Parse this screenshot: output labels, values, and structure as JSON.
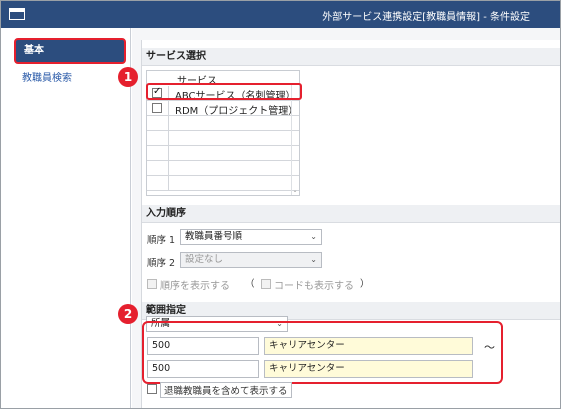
{
  "window": {
    "title": "外部サービス連携設定[教職員情報] - 条件設定",
    "icon": "window-icon"
  },
  "sidebar": {
    "items": [
      {
        "label": "基本",
        "active": true
      },
      {
        "label": "教職員検索",
        "active": false
      }
    ]
  },
  "badges": {
    "one": "1",
    "two": "2"
  },
  "service_section": {
    "heading": "サービス選択",
    "column_header": "サービス",
    "rows": [
      {
        "label": "ABCサービス（名刺管理）",
        "checked": true
      },
      {
        "label": "RDM（プロジェクト管理）",
        "checked": false
      }
    ]
  },
  "order_section": {
    "heading": "入力順序",
    "order1_label": "順序 1",
    "order1_value": "教職員番号順",
    "order2_label": "順序 2",
    "order2_value": "設定なし",
    "show_order_label": "順序を表示する",
    "paren_open": "（",
    "show_code_label": "コードも表示する",
    "paren_close": "）"
  },
  "range_section": {
    "heading": "範囲指定",
    "field_select": "所属",
    "from_code": "500",
    "from_name": "キャリアセンター",
    "tilde": "〜",
    "to_code": "500",
    "to_name": "キャリアセンター",
    "include_retired_label": "退職教職員を含めて表示する"
  },
  "colors": {
    "titlebar": "#2c4d7e",
    "highlight": "#e5202e",
    "input_yellow": "#fffbd9"
  }
}
